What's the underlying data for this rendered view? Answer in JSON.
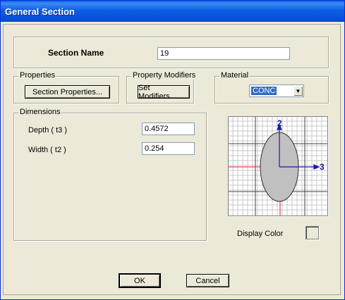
{
  "window": {
    "title": "General Section"
  },
  "section_name": {
    "label": "Section Name",
    "value": "19"
  },
  "properties": {
    "legend": "Properties",
    "button_label": "Section Properties..."
  },
  "property_modifiers": {
    "legend": "Property Modifiers",
    "button_label": "Set Modifiers..."
  },
  "material": {
    "legend": "Material",
    "selected": "CONC"
  },
  "dimensions": {
    "legend": "Dimensions",
    "depth_label": "Depth  ( t3 )",
    "depth_value": "0.4572",
    "width_label": "Width  ( t2 )",
    "width_value": "0.254"
  },
  "preview": {
    "axis_2_label": "2",
    "axis_3_label": "3",
    "shape": "ellipse",
    "fill_color": "#c0c0c0",
    "grid_color": "#c8c8c8",
    "axis_color": "#1a1aa0",
    "ref_line_color": "#e02020"
  },
  "display_color": {
    "label": "Display Color"
  },
  "buttons": {
    "ok": "OK",
    "cancel": "Cancel"
  }
}
